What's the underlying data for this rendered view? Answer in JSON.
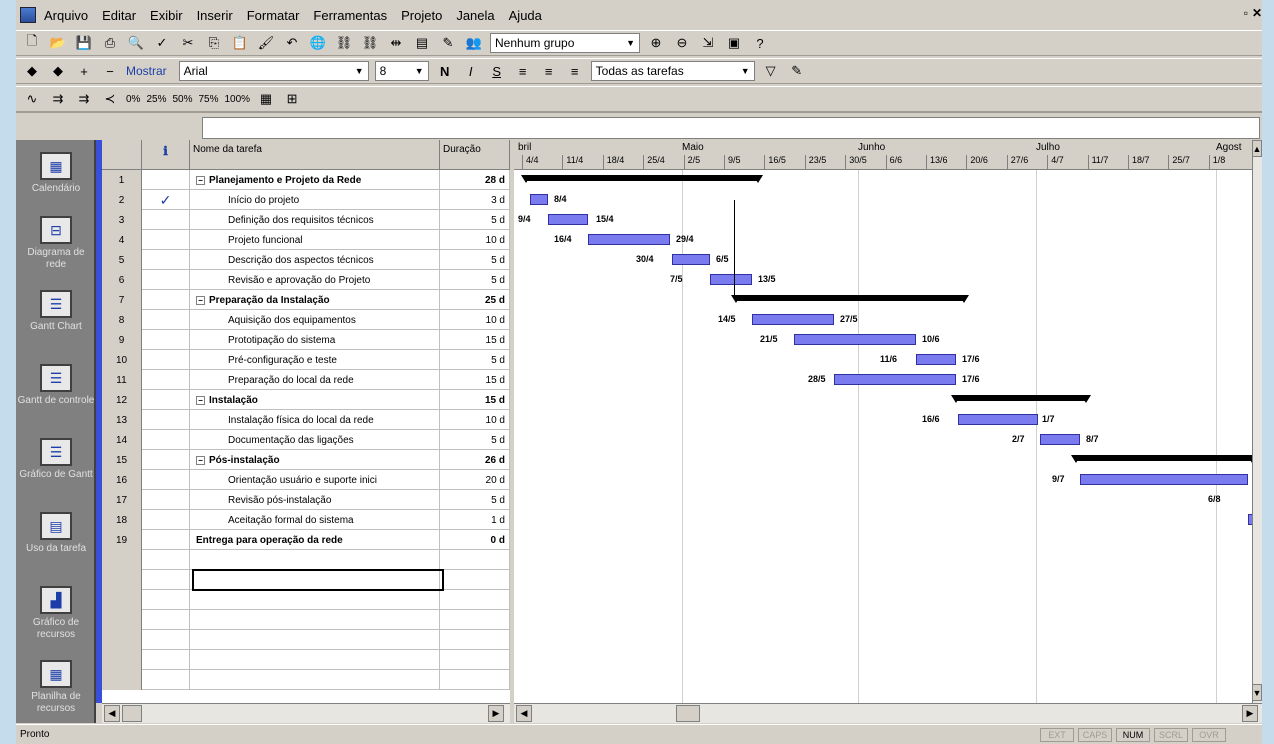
{
  "menu": [
    "Arquivo",
    "Editar",
    "Exibir",
    "Inserir",
    "Formatar",
    "Ferramentas",
    "Projeto",
    "Janela",
    "Ajuda"
  ],
  "toolbar1": {
    "group_value": "Nenhum grupo"
  },
  "toolbar2": {
    "show_label": "Mostrar",
    "font_value": "Arial",
    "size_value": "8",
    "filter_value": "Todas as tarefas",
    "bold": "N",
    "italic": "I",
    "underline": "S"
  },
  "toolbar3": {
    "percents": [
      "0%",
      "25%",
      "50%",
      "75%",
      "100%"
    ]
  },
  "viewbar": [
    {
      "label": "Calendário",
      "icon": "calendar-icon"
    },
    {
      "label": "Diagrama de rede",
      "icon": "network-diagram-icon"
    },
    {
      "label": "Gantt Chart",
      "icon": "gantt-chart-icon"
    },
    {
      "label": "Gantt de controle",
      "icon": "tracking-gantt-icon"
    },
    {
      "label": "Gráfico de Gantt",
      "icon": "gantt-icon"
    },
    {
      "label": "Uso da tarefa",
      "icon": "task-usage-icon"
    },
    {
      "label": "Gráfico de recursos",
      "icon": "resource-graph-icon"
    },
    {
      "label": "Planilha de recursos",
      "icon": "resource-sheet-icon"
    }
  ],
  "table": {
    "headers": {
      "info": "ℹ",
      "name": "Nome da tarefa",
      "duration": "Duração"
    },
    "rows": [
      {
        "id": "1",
        "name": "Planejamento e Projeto da Rede",
        "duration": "28 d",
        "summary": true,
        "check": ""
      },
      {
        "id": "2",
        "name": "Início do projeto",
        "duration": "3 d",
        "summary": false,
        "check": "✓"
      },
      {
        "id": "3",
        "name": "Definição dos requisitos técnicos",
        "duration": "5 d",
        "summary": false,
        "check": ""
      },
      {
        "id": "4",
        "name": "Projeto funcional",
        "duration": "10 d",
        "summary": false,
        "check": ""
      },
      {
        "id": "5",
        "name": "Descrição dos aspectos técnicos",
        "duration": "5 d",
        "summary": false,
        "check": ""
      },
      {
        "id": "6",
        "name": "Revisão e aprovação do Projeto",
        "duration": "5 d",
        "summary": false,
        "check": ""
      },
      {
        "id": "7",
        "name": "Preparação da Instalação",
        "duration": "25 d",
        "summary": true,
        "check": ""
      },
      {
        "id": "8",
        "name": "Aquisição dos equipamentos",
        "duration": "10 d",
        "summary": false,
        "check": ""
      },
      {
        "id": "9",
        "name": "Prototipação do sistema",
        "duration": "15 d",
        "summary": false,
        "check": ""
      },
      {
        "id": "10",
        "name": "Pré-configuração e teste",
        "duration": "5 d",
        "summary": false,
        "check": ""
      },
      {
        "id": "11",
        "name": "Preparação do local da rede",
        "duration": "15 d",
        "summary": false,
        "check": ""
      },
      {
        "id": "12",
        "name": "Instalação",
        "duration": "15 d",
        "summary": true,
        "check": ""
      },
      {
        "id": "13",
        "name": "Instalação física do local da rede",
        "duration": "10 d",
        "summary": false,
        "check": ""
      },
      {
        "id": "14",
        "name": "Documentação das ligações",
        "duration": "5 d",
        "summary": false,
        "check": ""
      },
      {
        "id": "15",
        "name": "Pós-instalação",
        "duration": "26 d",
        "summary": true,
        "check": ""
      },
      {
        "id": "16",
        "name": "Orientação usuário e suporte inici",
        "duration": "20 d",
        "summary": false,
        "check": ""
      },
      {
        "id": "17",
        "name": "Revisão pós-instalação",
        "duration": "5 d",
        "summary": false,
        "check": ""
      },
      {
        "id": "18",
        "name": "Aceitação formal do sistema",
        "duration": "1 d",
        "summary": false,
        "check": ""
      },
      {
        "id": "19",
        "name": "Entrega para operação da rede",
        "duration": "0 d",
        "summary": true,
        "check": ""
      }
    ]
  },
  "gantt": {
    "months": [
      "bril",
      "Maio",
      "Junho",
      "Julho",
      "Agost"
    ],
    "weeks": [
      "4/4",
      "11/4",
      "18/4",
      "25/4",
      "2/5",
      "9/5",
      "16/5",
      "23/5",
      "30/5",
      "6/6",
      "13/6",
      "20/6",
      "27/6",
      "4/7",
      "11/7",
      "18/7",
      "25/7",
      "1/8"
    ],
    "labels": [
      "8/4",
      "15/4",
      "9/4",
      "16/4",
      "29/4",
      "30/4",
      "6/5",
      "7/5",
      "13/5",
      "14/5",
      "27/5",
      "21/5",
      "10/6",
      "11/6",
      "17/6",
      "28/5",
      "17/6",
      "16/6",
      "1/7",
      "2/7",
      "8/7",
      "9/7",
      "6/8"
    ]
  },
  "status": {
    "text": "Pronto",
    "indicators": [
      "EXT",
      "CAPS",
      "NUM",
      "SCRL",
      "OVR"
    ]
  }
}
